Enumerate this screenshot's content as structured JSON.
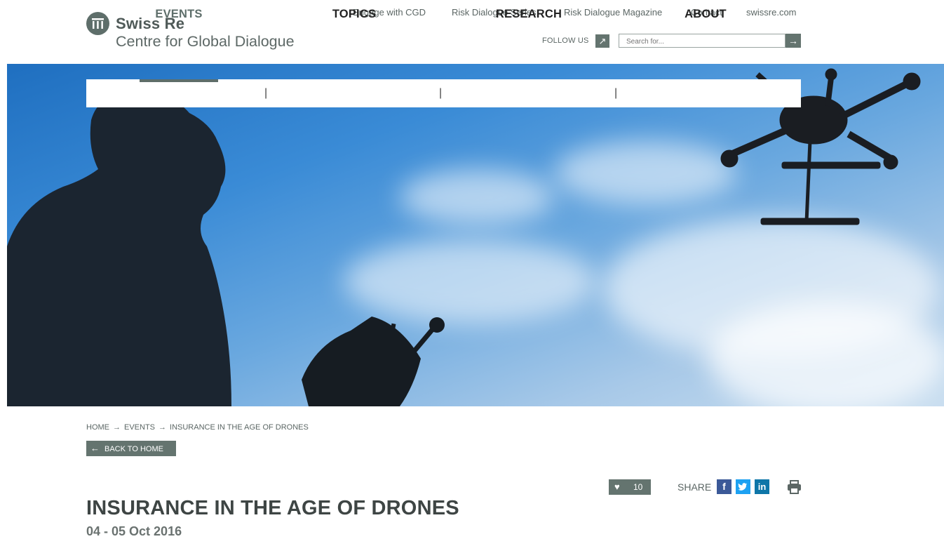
{
  "brand": {
    "name": "Swiss Re",
    "subtitle": "Centre for Global Dialogue"
  },
  "top_links": [
    "Engage with CGD",
    "Risk Dialogue Series",
    "Risk Dialogue Magazine",
    "Contact",
    "swissre.com"
  ],
  "follow": {
    "label": "FOLLOW US"
  },
  "search": {
    "placeholder": "Search for..."
  },
  "nav": {
    "items": [
      "EVENTS",
      "TOPICS",
      "RESEARCH",
      "ABOUT"
    ],
    "active": "EVENTS",
    "separator": "|"
  },
  "breadcrumb": [
    "HOME",
    "EVENTS",
    "INSURANCE IN THE AGE OF DRONES"
  ],
  "back_button": {
    "label": "BACK TO HOME"
  },
  "likes": {
    "count": "10"
  },
  "share": {
    "label": "SHARE",
    "networks": [
      "facebook",
      "twitter",
      "linkedin"
    ],
    "colors": {
      "facebook": "#3b5998",
      "twitter": "#1da1f2",
      "linkedin": "#0e76a8"
    }
  },
  "article": {
    "title": "INSURANCE IN THE AGE OF DRONES",
    "date": "04 - 05 Oct 2016"
  },
  "colors": {
    "accent": "#64746f",
    "text": "#3e4544"
  }
}
